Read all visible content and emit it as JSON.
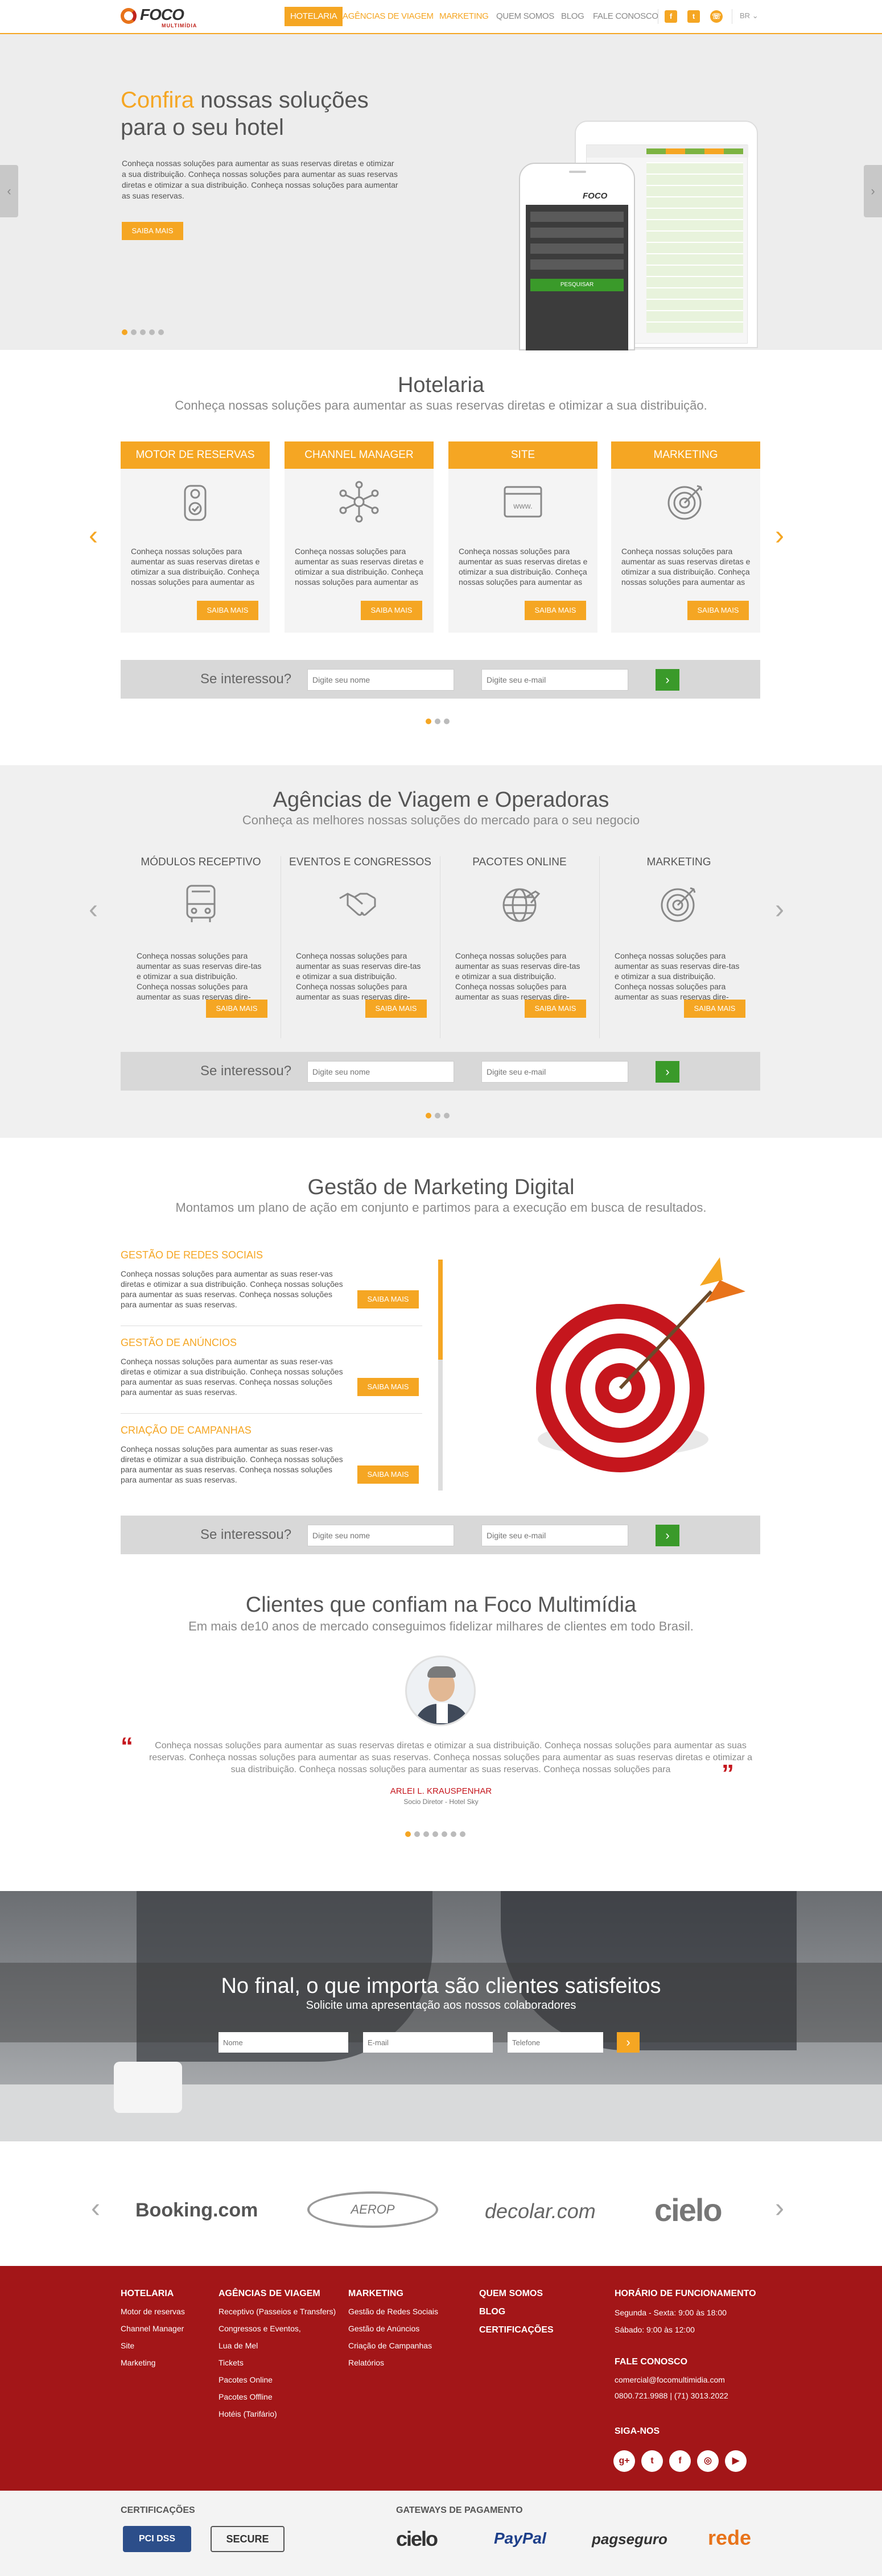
{
  "header": {
    "logo_text": "FOCO",
    "logo_sub": "MULTIMÍDIA",
    "nav": [
      "HOTELARIA",
      "AGÊNCIAS DE VIAGEM",
      "MARKETING",
      "QUEM SOMOS",
      "BLOG",
      "FALE CONOSCO"
    ],
    "lang": "BR"
  },
  "hero": {
    "title_highlight": "Confira",
    "title_rest": " nossas soluções",
    "title_line2": "para o seu hotel",
    "text": "Conheça nossas soluções para aumentar as suas reservas diretas e otimizar a sua distribuição. Conheça nossas soluções para aumentar as suas reservas diretas e otimizar a sua distribuição. Conheça nossas soluções para aumentar as suas reservas.",
    "button": "SAIBA MAIS",
    "phone_logo": "FOCO",
    "phone_btn": "PESQUISAR"
  },
  "hotelaria": {
    "title": "Hotelaria",
    "subtitle": "Conheça nossas soluções para aumentar as suas reservas diretas e otimizar a sua distribuição.",
    "cards": [
      {
        "title": "MOTOR DE RESERVAS",
        "icon": "door-hanger-icon"
      },
      {
        "title": "CHANNEL MANAGER",
        "icon": "network-icon"
      },
      {
        "title": "SITE",
        "icon": "browser-www-icon"
      },
      {
        "title": "MARKETING",
        "icon": "target-icon"
      }
    ],
    "card_text": "Conheça nossas soluções para aumentar as suas reservas diretas e otimizar a sua distribuição. Conheça nossas soluções para aumentar as suas reservas dire-",
    "button": "SAIBA MAIS"
  },
  "agencias": {
    "title": "Agências de Viagem e Operadoras",
    "subtitle": "Conheça as melhores nossas soluções do mercado para o seu negocio",
    "cols": [
      {
        "title": "MÓDULOS RECEPTIVO",
        "icon": "bus-icon"
      },
      {
        "title": "EVENTOS E CONGRESSOS",
        "icon": "handshake-icon"
      },
      {
        "title": "PACOTES ONLINE",
        "icon": "globe-plane-icon"
      },
      {
        "title": "MARKETING",
        "icon": "target-icon"
      }
    ],
    "col_text": "Conheça nossas soluções para aumentar as suas reservas dire-tas e otimizar a sua distribuição. Conheça nossas soluções para aumentar as suas reservas dire-",
    "button": "SAIBA MAIS"
  },
  "lead": {
    "label": "Se interessou?",
    "name_ph": "Digite seu nome",
    "email_ph": "Digite seu e-mail"
  },
  "marketing": {
    "title": "Gestão de Marketing Digital",
    "subtitle": "Montamos um plano de ação em conjunto e partimos para a execução em busca de resultados.",
    "items": [
      {
        "title": "GESTÃO DE REDES SOCIAIS"
      },
      {
        "title": "GESTÃO DE ANÚNCIOS"
      },
      {
        "title": "CRIAÇÃO DE CAMPANHAS"
      }
    ],
    "item_text": "Conheça nossas soluções para aumentar as suas reser-vas diretas e otimizar a sua distribuição. Conheça nossas soluções para aumentar as suas reservas. Conheça nossas soluções para aumentar as suas reservas.",
    "button": "SAIBA MAIS"
  },
  "clientes": {
    "title": "Clientes que confiam na Foco Multimídia",
    "subtitle": "Em mais de10 anos de mercado conseguimos fidelizar milhares de clientes em todo Brasil.",
    "quote": "Conheça nossas soluções para aumentar as suas reservas diretas e otimizar a sua distribuição. Conheça nossas soluções para aumentar as suas reservas. Conheça nossas soluções para aumentar as suas reservas. Conheça nossas soluções para aumentar as suas reservas diretas e otimizar a sua distribuição. Conheça nossas soluções para aumentar as suas reservas. Conheça nossas soluções para",
    "author": "ARLEI L. KRAUSPENHAR",
    "role": "Socio Diretor - Hotel Sky"
  },
  "cta": {
    "title": "No final, o que importa são clientes satisfeitos",
    "subtitle": "Solicite uma apresentação aos nossos colaboradores",
    "name_ph": "Nome",
    "email_ph": "E-mail",
    "phone_ph": "Telefone"
  },
  "partners": [
    "Booking.com",
    "AEROP",
    "decolar.com",
    "cielo"
  ],
  "footer": {
    "hotelaria": {
      "title": "HOTELARIA",
      "items": [
        "Motor de reservas",
        "Channel Manager",
        "Site",
        "Marketing"
      ]
    },
    "agencias": {
      "title": "AGÊNCIAS DE VIAGEM",
      "items": [
        "Receptivo (Passeios e Transfers)",
        "Congressos e Eventos,",
        "Lua de Mel",
        "Tickets",
        "Pacotes Online",
        "Pacotes Offline",
        "Hotéis (Tarifário)"
      ]
    },
    "marketing": {
      "title": "MARKETING",
      "items": [
        "Gestão de Redes Sociais",
        "Gestão de Anúncios",
        "Criação de Campanhas",
        "Relatórios"
      ]
    },
    "links": [
      "QUEM SOMOS",
      "BLOG",
      "CERTIFICAÇÕES"
    ],
    "horario": {
      "title": "HORÁRIO DE FUNCIONAMENTO",
      "l1": "Segunda - Sexta: 9:00 às 18:00",
      "l2": "Sábado: 9:00 às 12:00"
    },
    "contato": {
      "title": "FALE CONOSCO",
      "email": "comercial@focomultimidia.com",
      "phone": "0800.721.9988 | (71) 3013.2022"
    },
    "siga": "SIGA-NOS"
  },
  "bottom": {
    "cert_title": "CERTIFICAÇÕES",
    "pci": "PCI DSS",
    "secure": "SECURE",
    "gw_title": "GATEWAYS DE PAGAMENTO",
    "gateways": [
      "cielo",
      "PayPal",
      "pagseguro",
      "rede"
    ]
  },
  "colors": {
    "accent": "#f5a623",
    "footer": "#a31618",
    "green": "#3a9a2a"
  }
}
